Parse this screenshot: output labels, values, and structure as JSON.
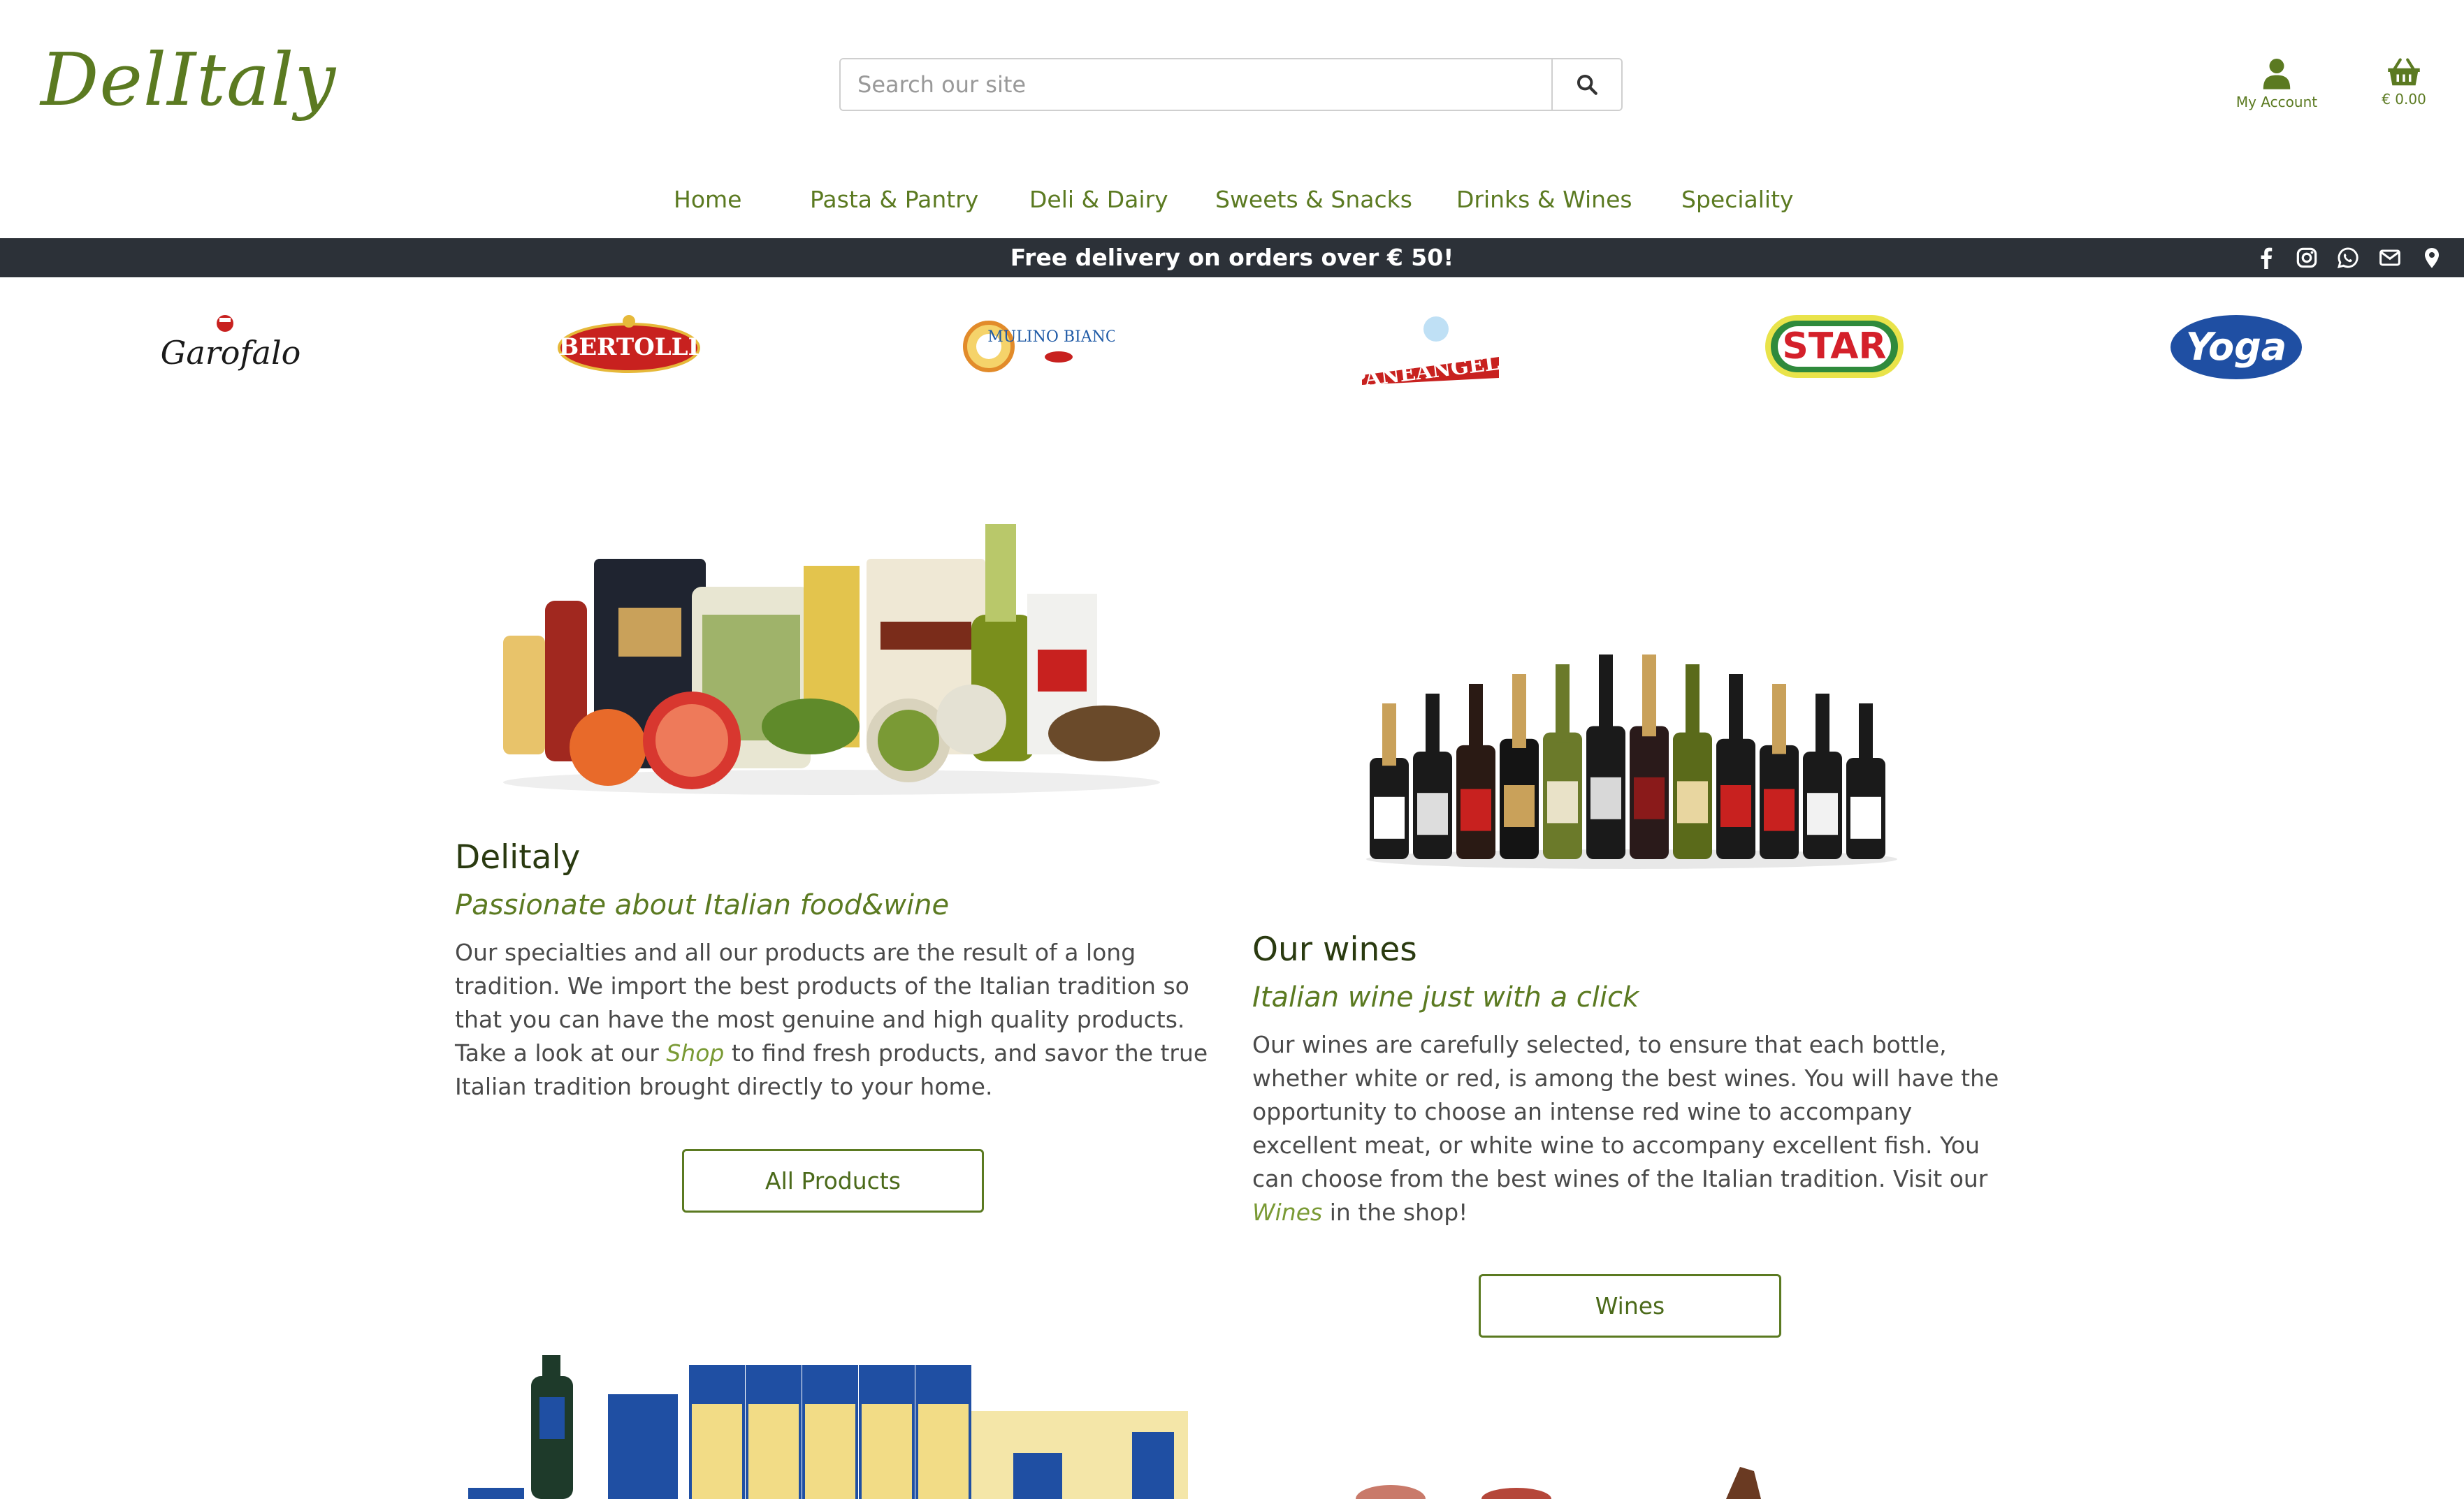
{
  "header": {
    "logo": "DelItaly",
    "search_placeholder": "Search our site",
    "account_label": "My Account",
    "cart_total": "€ 0.00"
  },
  "nav": [
    {
      "label": "Home"
    },
    {
      "label": "Pasta & Pantry"
    },
    {
      "label": "Deli & Dairy"
    },
    {
      "label": "Sweets & Snacks"
    },
    {
      "label": "Drinks & Wines"
    },
    {
      "label": "Speciality"
    }
  ],
  "banner": {
    "text": "Free delivery on orders over € 50!",
    "social_icons": [
      "facebook-icon",
      "instagram-icon",
      "whatsapp-icon",
      "envelope-icon",
      "map-marker-icon"
    ]
  },
  "brands": [
    {
      "name": "Garofalo",
      "color": "#1a1a1a"
    },
    {
      "name": "BERTOLLI",
      "color": "#c8211f"
    },
    {
      "name": "MULINO BIANCO",
      "color": "#1f5aa6"
    },
    {
      "name": "PANEANGELI",
      "color": "#c8211f"
    },
    {
      "name": "STAR",
      "color": "#d4202a"
    },
    {
      "name": "Yoga",
      "color": "#1f4fa3"
    }
  ],
  "sections": {
    "delitaly": {
      "title": "Delitaly",
      "subtitle": "Passionate about Italian food&wine",
      "text_before": "Our specialties and all our products are the result of a long tradition. We import the best products of the Italian tradition so that you can have the most genuine and high quality products. Take a look at our ",
      "link": "Shop",
      "text_after": " to find fresh products, and savor the true Italian tradition brought directly to your home.",
      "button": "All Products"
    },
    "wines": {
      "title": "Our wines",
      "subtitle": "Italian wine just with a click",
      "text_before": "Our wines are carefully selected, to ensure that each bottle, whether white or red, is among the best wines. You will have the opportunity to choose an intense red wine to accompany excellent meat, or white wine to accompany excellent fish. You can choose from the best wines of the Italian tradition. Visit our ",
      "link": "Wines",
      "text_after": " in the shop!",
      "button": "Wines"
    }
  },
  "colors": {
    "accent": "#5b7a21",
    "banner_bg": "#2c3138",
    "text": "#4a4a4a"
  }
}
